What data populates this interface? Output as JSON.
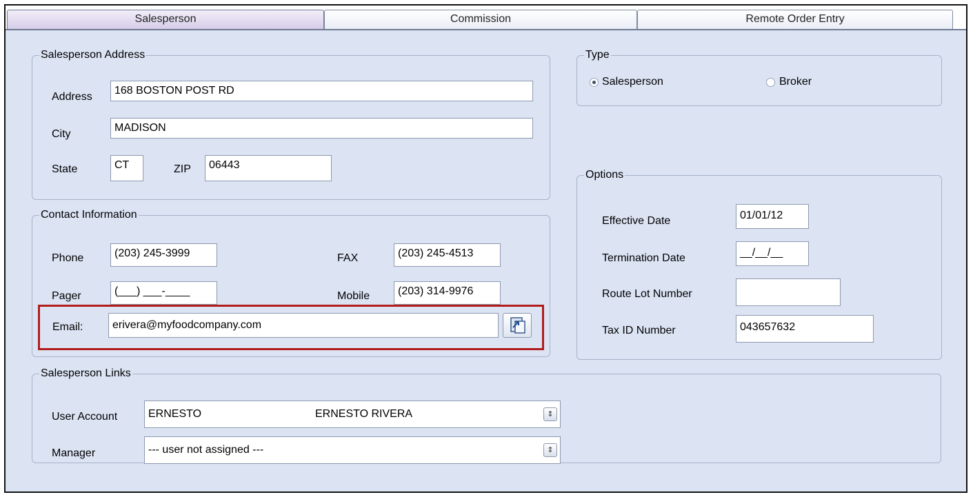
{
  "tabs": [
    {
      "label": "Salesperson"
    },
    {
      "label": "Commission"
    },
    {
      "label": "Remote Order Entry"
    }
  ],
  "address_group": {
    "legend": "Salesperson Address",
    "address_label": "Address",
    "address_value": "168 BOSTON POST RD",
    "city_label": "City",
    "city_value": "MADISON",
    "state_label": "State",
    "state_value": "CT",
    "zip_label": "ZIP",
    "zip_value": "06443"
  },
  "contact_group": {
    "legend": "Contact Information",
    "phone_label": "Phone",
    "phone_value": "(203) 245-3999",
    "fax_label": "FAX",
    "fax_value": "(203) 245-4513",
    "pager_label": "Pager",
    "pager_value": "(___) ___-____",
    "mobile_label": "Mobile",
    "mobile_value": "(203) 314-9976",
    "email_label": "Email:",
    "email_value": "erivera@myfoodcompany.com"
  },
  "links_group": {
    "legend": "Salesperson Links",
    "user_account_label": "User Account",
    "user_account_id": "ERNESTO",
    "user_account_name": "ERNESTO RIVERA",
    "manager_label": "Manager",
    "manager_value": "--- user not assigned ---"
  },
  "type_group": {
    "legend": "Type",
    "options": [
      {
        "label": "Salesperson",
        "selected": true
      },
      {
        "label": "Broker",
        "selected": false
      }
    ]
  },
  "options_group": {
    "legend": "Options",
    "effective_date_label": "Effective Date",
    "effective_date_value": "01/01/12",
    "termination_date_label": "Termination Date",
    "termination_date_value": "__/__/__",
    "route_lot_label": "Route Lot Number",
    "route_lot_value": "",
    "tax_id_label": "Tax ID Number",
    "tax_id_value": "043657632"
  },
  "colors": {
    "background": "#dce4f4",
    "highlight": "#b01c1c",
    "active_tab": "#d5cde9"
  },
  "icons": {
    "email_button": "send-email-icon",
    "dropdown": "spinner-arrows-icon"
  }
}
